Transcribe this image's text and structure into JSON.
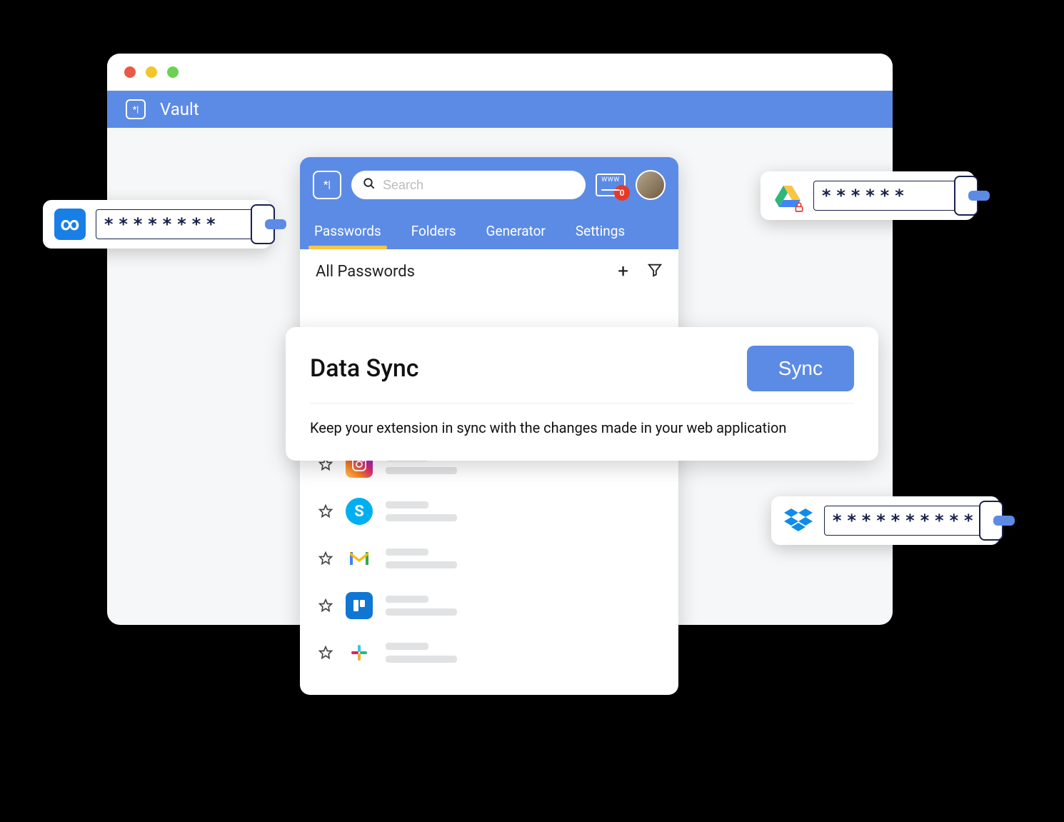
{
  "app": {
    "title": "Vault",
    "logo_text": "*|"
  },
  "extension": {
    "logo_text": "*|",
    "search_placeholder": "Search",
    "notifications_count": "0",
    "tabs": [
      {
        "label": "Passwords",
        "active": true
      },
      {
        "label": "Folders",
        "active": false
      },
      {
        "label": "Generator",
        "active": false
      },
      {
        "label": "Settings",
        "active": false
      }
    ],
    "section_title": "All Passwords",
    "items": [
      {
        "icon": "instagram-icon"
      },
      {
        "icon": "skype-icon"
      },
      {
        "icon": "gmail-icon"
      },
      {
        "icon": "trello-icon"
      },
      {
        "icon": "slack-icon"
      }
    ]
  },
  "sync_card": {
    "title": "Data Sync",
    "button_label": "Sync",
    "description": "Keep your extension in sync with the changes made in your web application"
  },
  "pills": {
    "left": {
      "brand": "infinity-icon",
      "masked": "********"
    },
    "top_right": {
      "brand": "drive-icon",
      "masked": "******"
    },
    "bottom_right": {
      "brand": "dropbox-icon",
      "masked": "**********"
    }
  },
  "icons": {
    "search": "search-icon",
    "web_browser": "www-icon",
    "avatar": "avatar",
    "add": "plus-icon",
    "filter": "funnel-icon",
    "star": "star-icon",
    "phone": "phone-icon",
    "lock": "lock-icon"
  }
}
